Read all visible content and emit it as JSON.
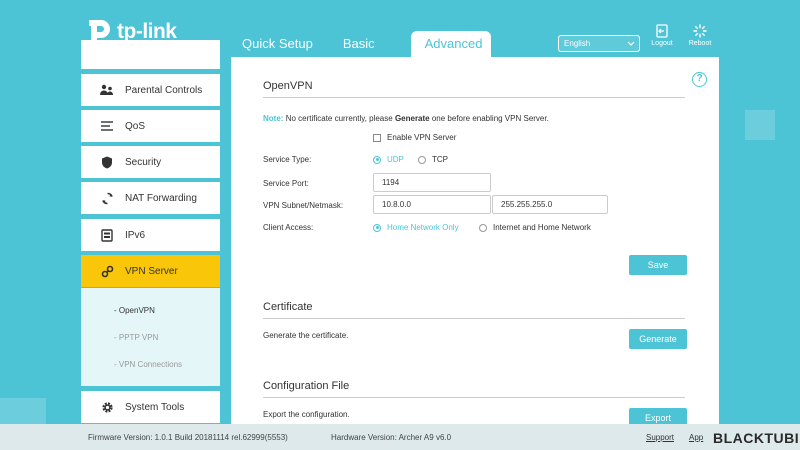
{
  "brand": {
    "logo_text": "tp-link"
  },
  "nav_tabs": [
    {
      "label": "Quick Setup",
      "active": false
    },
    {
      "label": "Basic",
      "active": false
    },
    {
      "label": "Advanced",
      "active": true
    }
  ],
  "header": {
    "language": "English",
    "logout_label": "Logout",
    "reboot_label": "Reboot"
  },
  "sidebar": {
    "items": [
      {
        "label": "Parental Controls",
        "icon": "parental-icon"
      },
      {
        "label": "QoS",
        "icon": "qos-icon"
      },
      {
        "label": "Security",
        "icon": "shield-icon"
      },
      {
        "label": "NAT Forwarding",
        "icon": "nat-icon"
      },
      {
        "label": "IPv6",
        "icon": "ipv6-icon"
      },
      {
        "label": "VPN Server",
        "icon": "vpn-icon",
        "active": true
      },
      {
        "label": "System Tools",
        "icon": "gear-icon"
      }
    ],
    "sub_items": [
      {
        "label": "- OpenVPN",
        "active": true
      },
      {
        "label": "- PPTP VPN",
        "active": false
      },
      {
        "label": "- VPN Connections",
        "active": false
      }
    ]
  },
  "openvpn": {
    "title": "OpenVPN",
    "note_label": "Note:",
    "note_pre": "No certificate currently, please",
    "note_bold": "Generate",
    "note_post": "one before enabling VPN Server.",
    "enable_label": "Enable VPN Server",
    "enable_checked": false,
    "service_type_label": "Service Type:",
    "service_type_options": [
      "UDP",
      "TCP"
    ],
    "service_type_selected": "UDP",
    "service_port_label": "Service Port:",
    "service_port_value": "1194",
    "subnet_label": "VPN Subnet/Netmask:",
    "subnet_value": "10.8.0.0",
    "netmask_value": "255.255.255.0",
    "client_access_label": "Client Access:",
    "client_access_options": [
      "Home Network Only",
      "Internet and Home Network"
    ],
    "client_access_selected": "Home Network Only",
    "save_label": "Save"
  },
  "certificate": {
    "title": "Certificate",
    "desc": "Generate the certificate.",
    "button_label": "Generate"
  },
  "config_file": {
    "title": "Configuration File",
    "desc": "Export the configuration.",
    "button_label": "Export"
  },
  "footer": {
    "firmware": "Firmware Version: 1.0.1 Build 20181114 rel.62999(5553)",
    "hardware": "Hardware Version: Archer A9 v6.0",
    "support_label": "Support",
    "app_label": "App",
    "watermark": "BLACKTUBI"
  },
  "colors": {
    "accent": "#4cc4d6",
    "active_menu": "#f9c60a",
    "background": "#4cc4d6"
  }
}
